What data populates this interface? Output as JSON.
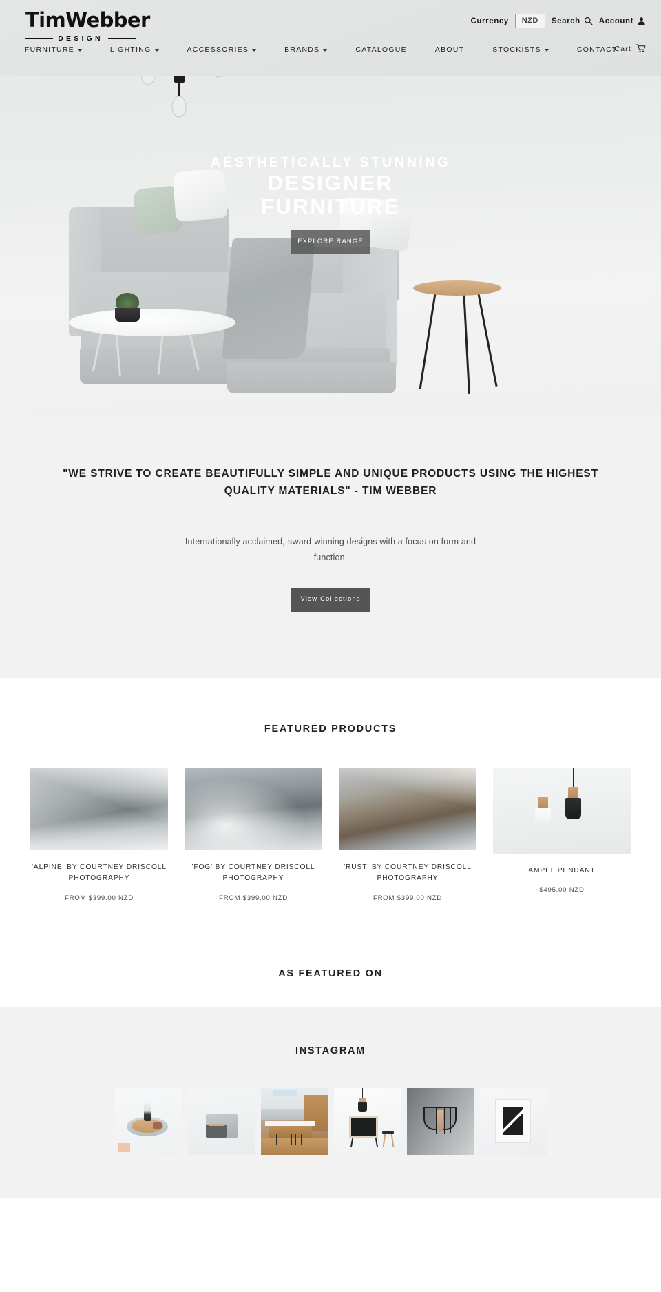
{
  "brand": {
    "name": "TimWebber",
    "tagline": "DESIGN"
  },
  "utility": {
    "currency_label": "Currency",
    "currency_value": "NZD",
    "search_label": "Search",
    "account_label": "Account",
    "cart_label": "Cart"
  },
  "nav": {
    "items": [
      {
        "label": "FURNITURE",
        "has_dropdown": true
      },
      {
        "label": "LIGHTING",
        "has_dropdown": true
      },
      {
        "label": "ACCESSORIES",
        "has_dropdown": true
      },
      {
        "label": "BRANDS",
        "has_dropdown": true
      },
      {
        "label": "CATALOGUE",
        "has_dropdown": false
      },
      {
        "label": "ABOUT",
        "has_dropdown": false
      },
      {
        "label": "STOCKISTS",
        "has_dropdown": true
      },
      {
        "label": "CONTACT",
        "has_dropdown": false
      }
    ]
  },
  "hero": {
    "kicker": "AESTHETICALLY STUNNING",
    "title_line1": "DESIGNER",
    "title_line2": "FURNITURE",
    "cta": "EXPLORE RANGE"
  },
  "quote": {
    "heading": "\"WE STRIVE TO CREATE BEAUTIFULLY SIMPLE AND UNIQUE PRODUCTS USING THE HIGHEST QUALITY MATERIALS\" - TIM WEBBER",
    "subtext": "Internationally acclaimed, award-winning designs with a focus on form and function.",
    "cta": "View Collections"
  },
  "featured": {
    "title": "FEATURED PRODUCTS",
    "products": [
      {
        "title": "'ALPINE' BY COURTNEY DRISCOLL PHOTOGRAPHY",
        "price": "FROM $399.00 NZD"
      },
      {
        "title": "'FOG' BY COURTNEY DRISCOLL PHOTOGRAPHY",
        "price": "FROM $399.00 NZD"
      },
      {
        "title": "'RUST' BY COURTNEY DRISCOLL PHOTOGRAPHY",
        "price": "FROM $399.00 NZD"
      },
      {
        "title": "AMPEL PENDANT",
        "price": "$495.00 NZD"
      }
    ]
  },
  "featured_on": {
    "title": "AS FEATURED ON"
  },
  "instagram": {
    "title": "INSTAGRAM",
    "posts": [
      {
        "alt": "wooden tray with hourglass"
      },
      {
        "alt": "grey storage cube"
      },
      {
        "alt": "kitchen island with stools"
      },
      {
        "alt": "black sideboard with pendant and stool"
      },
      {
        "alt": "black wire magazine rack on wall"
      },
      {
        "alt": "black and white framed artwork"
      }
    ]
  },
  "colors": {
    "accent_dark": "#555555",
    "text": "#2b2b2b",
    "band_grey": "#f2f2f2",
    "header_grey": "#e4e6e5"
  }
}
